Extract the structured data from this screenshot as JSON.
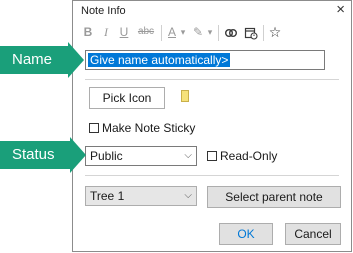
{
  "dialog": {
    "title": "Note Info",
    "close_glyph": "×"
  },
  "toolbar": {
    "bold": "B",
    "italic": "I",
    "underline": "U",
    "strikethrough": "abc",
    "font_color": "A",
    "dropdown_glyph": "▾",
    "highlight_glyph": "✎",
    "star_glyph": "☆"
  },
  "name_field": {
    "value": "Give name automatically>"
  },
  "icon_section": {
    "pick_icon_label": "Pick Icon",
    "note_icon_color": "#f6e27a"
  },
  "sticky": {
    "label": "Make Note Sticky",
    "checked": false
  },
  "status": {
    "value": "Public",
    "readonly_label": "Read-Only",
    "readonly_checked": false
  },
  "parent": {
    "tree_value": "Tree 1",
    "select_parent_label": "Select parent note"
  },
  "footer": {
    "ok_label": "OK",
    "cancel_label": "Cancel"
  },
  "callouts": {
    "name_label": "Name",
    "status_label": "Status",
    "color": "#1a9f7a"
  }
}
